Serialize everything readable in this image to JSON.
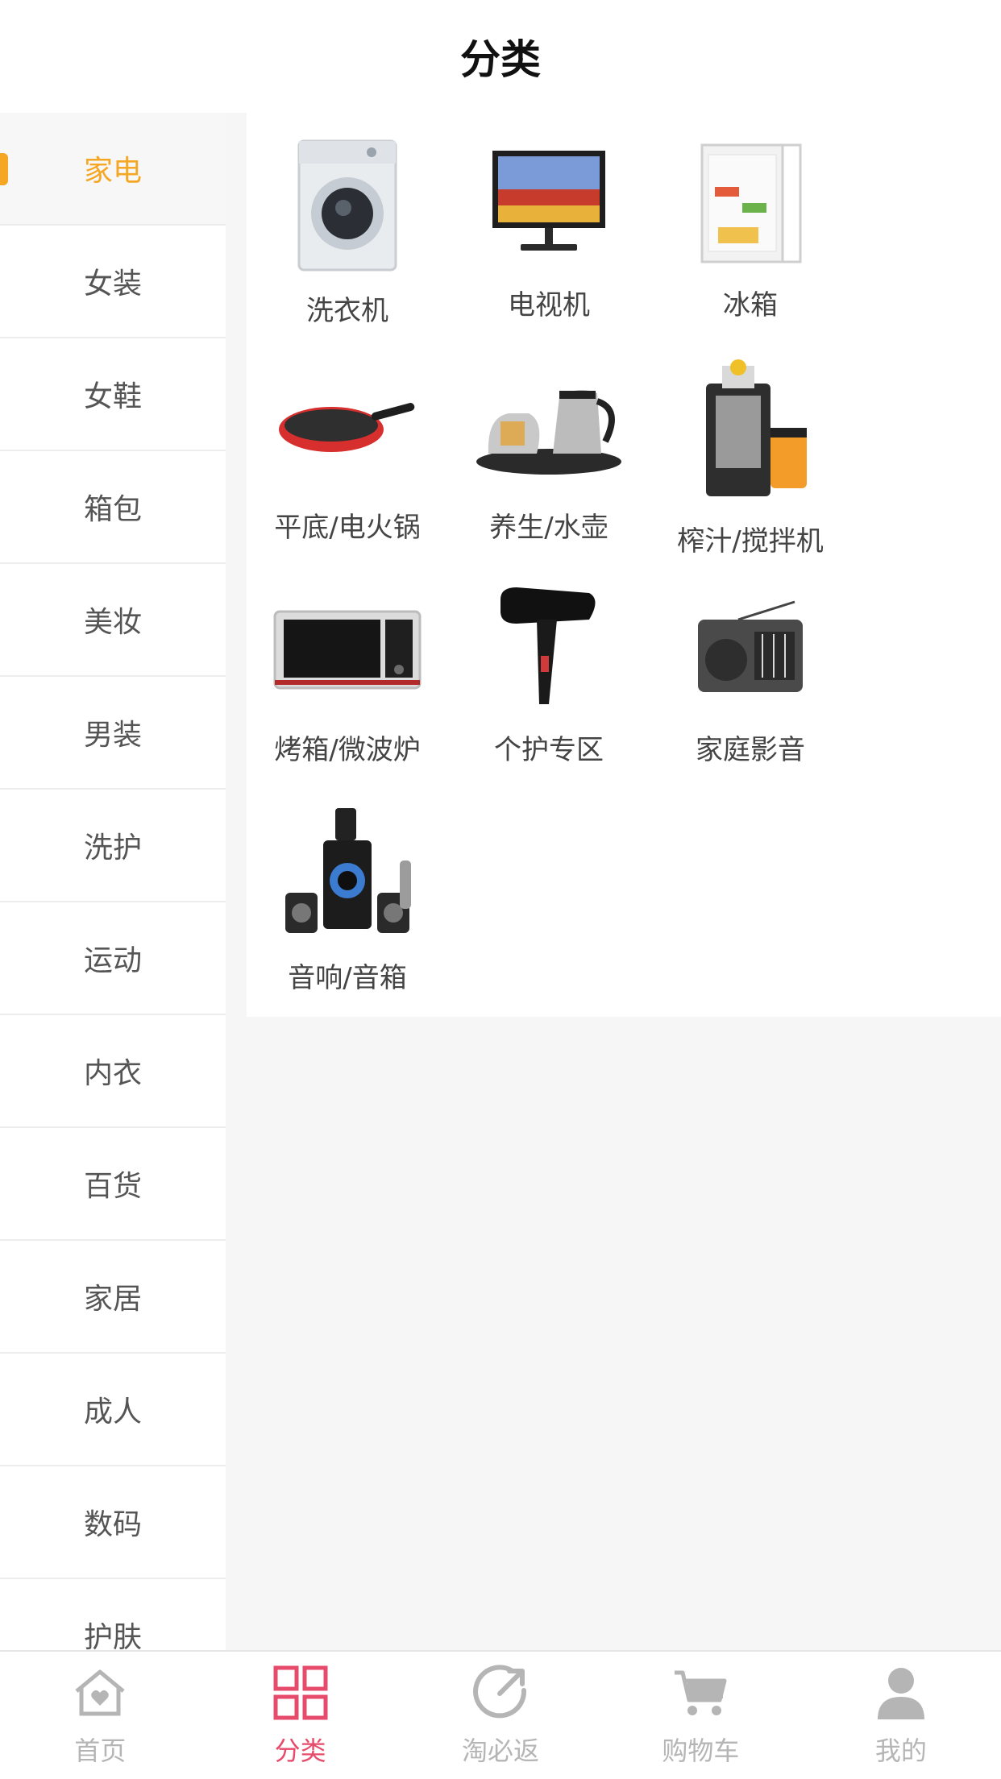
{
  "header": {
    "title": "分类"
  },
  "sidebar": {
    "items": [
      {
        "label": "家电",
        "active": true
      },
      {
        "label": "女装"
      },
      {
        "label": "女鞋"
      },
      {
        "label": "箱包"
      },
      {
        "label": "美妆"
      },
      {
        "label": "男装"
      },
      {
        "label": "洗护"
      },
      {
        "label": "运动"
      },
      {
        "label": "内衣"
      },
      {
        "label": "百货"
      },
      {
        "label": "家居"
      },
      {
        "label": "成人"
      },
      {
        "label": "数码"
      },
      {
        "label": "护肤"
      }
    ]
  },
  "subcategories": [
    {
      "label": "洗衣机",
      "icon": "washing-machine-icon"
    },
    {
      "label": "电视机",
      "icon": "tv-icon"
    },
    {
      "label": "冰箱",
      "icon": "fridge-icon"
    },
    {
      "label": "平底/电火锅",
      "icon": "frying-pan-icon"
    },
    {
      "label": "养生/水壶",
      "icon": "kettle-icon"
    },
    {
      "label": "榨汁/搅拌机",
      "icon": "juicer-icon"
    },
    {
      "label": "烤箱/微波炉",
      "icon": "microwave-icon"
    },
    {
      "label": "个护专区",
      "icon": "hair-dryer-icon"
    },
    {
      "label": "家庭影音",
      "icon": "radio-icon"
    },
    {
      "label": "音响/音箱",
      "icon": "speaker-icon"
    }
  ],
  "tabbar": {
    "items": [
      {
        "label": "首页",
        "icon": "home-icon"
      },
      {
        "label": "分类",
        "icon": "category-grid-icon",
        "active": true
      },
      {
        "label": "淘必返",
        "icon": "cashback-icon"
      },
      {
        "label": "购物车",
        "icon": "cart-icon"
      },
      {
        "label": "我的",
        "icon": "user-icon"
      }
    ]
  },
  "colors": {
    "accent_sidebar": "#f5a623",
    "accent_tab": "#e74b6b",
    "tab_inactive": "#b5b5b5"
  }
}
